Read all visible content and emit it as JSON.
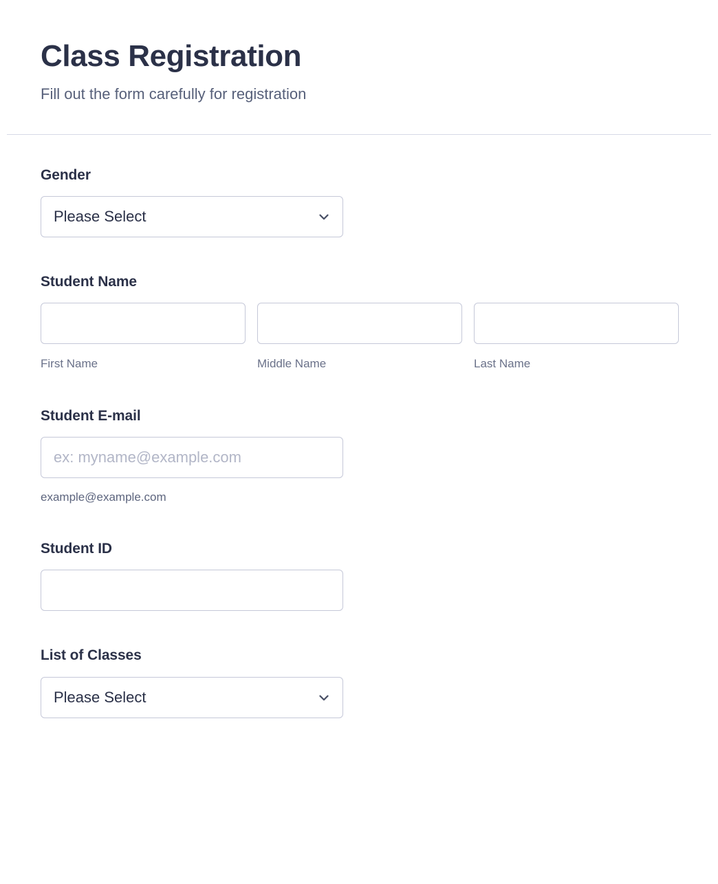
{
  "header": {
    "title": "Class Registration",
    "subtitle": "Fill out the form carefully for registration"
  },
  "theme": {
    "background": "#ffffff",
    "heading_color": "#2b3148",
    "subtitle_color": "#57607a",
    "label_color": "#2b3148",
    "sublabel_color": "#6a7189",
    "border_color": "#c5c8d8",
    "divider_color": "#d7dae6",
    "placeholder_color": "#b2b6c7"
  },
  "fields": {
    "gender": {
      "label": "Gender",
      "selected": "Please Select",
      "icon": "chevron-down-icon"
    },
    "student_name": {
      "label": "Student Name",
      "parts": [
        {
          "value": "",
          "sublabel": "First Name"
        },
        {
          "value": "",
          "sublabel": "Middle Name"
        },
        {
          "value": "",
          "sublabel": "Last Name"
        }
      ]
    },
    "student_email": {
      "label": "Student E-mail",
      "value": "",
      "placeholder": "ex: myname@example.com",
      "hint": "example@example.com"
    },
    "student_id": {
      "label": "Student ID",
      "value": ""
    },
    "list_of_classes": {
      "label": "List of Classes",
      "selected": "Please Select",
      "icon": "chevron-down-icon"
    }
  }
}
